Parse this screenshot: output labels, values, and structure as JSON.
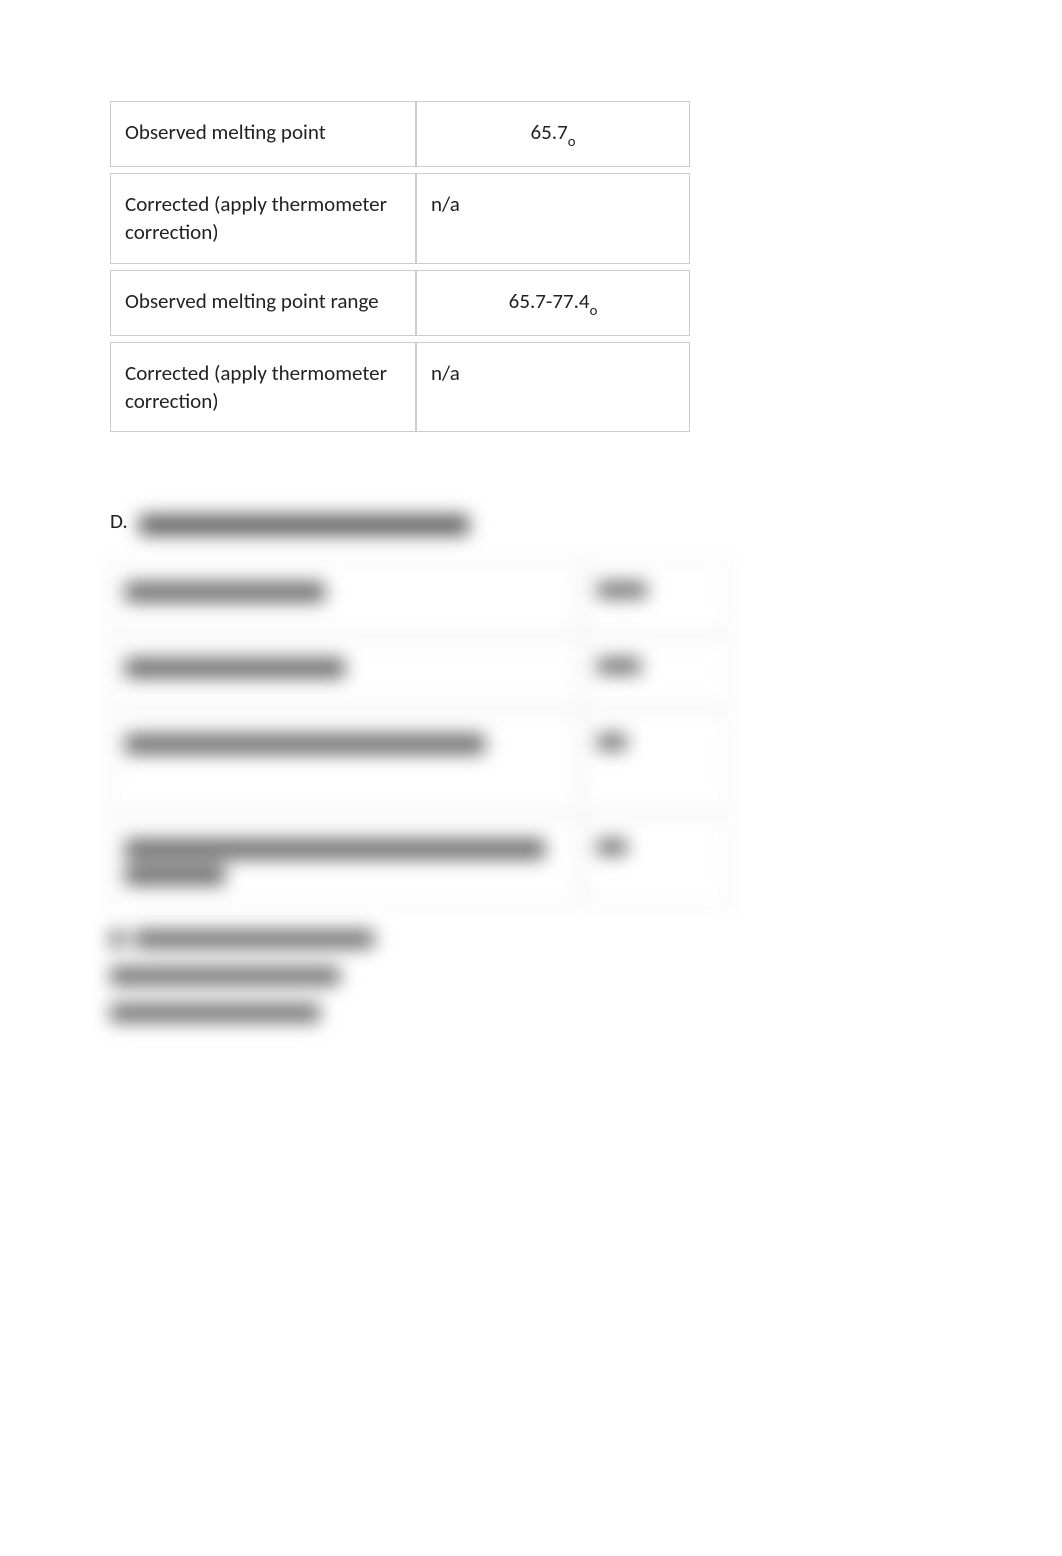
{
  "table1": {
    "rows": [
      {
        "label": "Observed melting point",
        "value": "65.7",
        "sub": "o",
        "center": true
      },
      {
        "label": "Corrected (apply thermometer correction)",
        "value": "n/a",
        "sub": "",
        "center": false
      },
      {
        "label": "Observed melting point range",
        "value": "65.7-77.4",
        "sub": "o",
        "center": true
      },
      {
        "label": "Corrected (apply thermometer correction)",
        "value": "n/a",
        "sub": "",
        "center": false
      }
    ]
  },
  "section_d": {
    "letter": "D.",
    "heading_redacted": "BOILING POINT OF LIQUID UNKNOWN"
  },
  "table2": {
    "rows": [
      {
        "label_redacted": "Barometric Pressure",
        "value_redacted": "Value"
      },
      {
        "label_redacted": "Observed boiling point",
        "value_redacted": "00"
      },
      {
        "label_redacted": "Corrected (apply thermometer correction)",
        "value_redacted": "n/a"
      },
      {
        "label_redacted": "Calculated, corrected from boiling point (apply pressure correction)",
        "value_redacted": "n/a"
      }
    ]
  },
  "section_e": {
    "letter_redacted": "E.",
    "heading_redacted": "UNKNOWN IDENTIFICATION"
  },
  "lines": [
    {
      "text_redacted": "Solid Unknown: Compound"
    },
    {
      "text_redacted": "Liquid Unknown: Hexane"
    }
  ]
}
